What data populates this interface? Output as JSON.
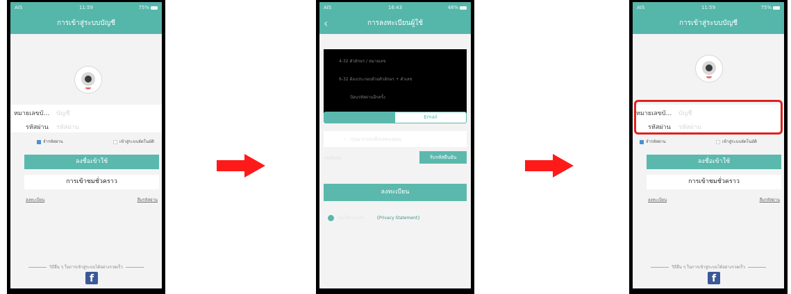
{
  "phone1": {
    "status": {
      "left": "AIS",
      "time": "11:59",
      "battery": "75%"
    },
    "title": "การเข้าสู่ระบบบัญชี",
    "username_label": "หมายเลขบั...",
    "username_placeholder": "บัญชี",
    "password_label": "รหัสผ่าน",
    "password_placeholder": "รหัสผ่าน",
    "remember_label": "จำรหัสผ่าน",
    "auto_login_label": "เข้าสู่ระบบอัตโนมัติ",
    "login_button": "ลงชื่อเข้าใช้",
    "guest_button": "การเข้าชมชั่วคราว",
    "register_link": "ลงทะเบียน",
    "forgot_link": "ลืมรหัสผ่าน",
    "other_methods": "วิธีอื่น ๆ ในการเข้าสู่ระบบได้อย่างรวดเร็ว"
  },
  "phone2": {
    "status": {
      "left": "AIS",
      "time": "16:43",
      "battery": "48%"
    },
    "title": "การลงทะเบียนผู้ใช้",
    "hint_1": "4-32 ตัวอักษร / หมายเลข",
    "hint_2": "6-32 ต้องประกอบด้วยตัวอักษร + ตัวเลข",
    "hint_3": "ป้อนรหัสผ่านอีกครั้ง",
    "tab_email": "Email",
    "email_placeholder": "กรุณากรอกอีเมลของคุณ",
    "code_placeholder": "รหัสยืนยัน",
    "get_code_button": "รับรหัสยืนยัน",
    "register_button": "ลงทะเบียน",
    "agree_text": "ฉันได้อ่านแล้ว",
    "privacy_link": "{Privacy Statement}"
  },
  "phone3": {
    "status": {
      "left": "AIS",
      "time": "11:59",
      "battery": "75%"
    },
    "title": "การเข้าสู่ระบบบัญชี",
    "username_label": "หมายเลขบั...",
    "username_placeholder": "บัญชี",
    "password_label": "รหัสผ่าน",
    "password_placeholder": "รหัสผ่าน",
    "remember_label": "จำรหัสผ่าน",
    "auto_login_label": "เข้าสู่ระบบอัตโนมัติ",
    "login_button": "ลงชื่อเข้าใช้",
    "guest_button": "การเข้าชมชั่วคราว",
    "register_link": "ลงทะเบียน",
    "forgot_link": "ลืมรหัสผ่าน",
    "other_methods": "วิธีอื่น ๆ ในการเข้าสู่ระบบได้อย่างรวดเร็ว"
  },
  "colors": {
    "teal": "#5bb8ad",
    "arrow": "#ff1a1a",
    "highlight": "#e02020",
    "facebook": "#3b5998"
  },
  "icons": [
    "camera-mascot-icon",
    "facebook-icon",
    "back-chevron-icon",
    "check-circle-icon",
    "chevron-down-icon",
    "arrow-right-icon"
  ]
}
